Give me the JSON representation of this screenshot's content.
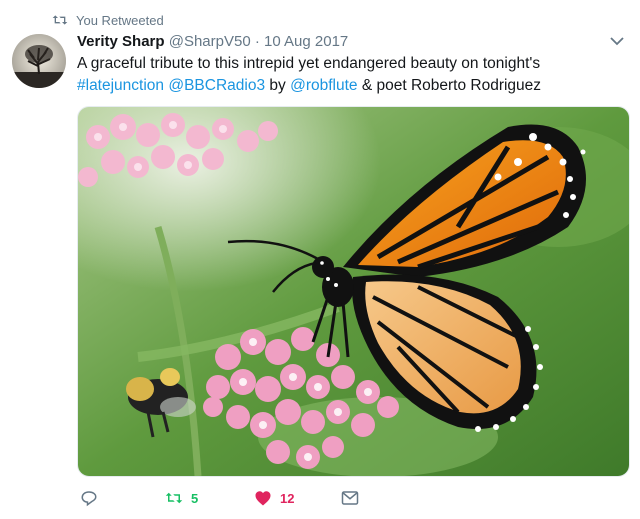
{
  "retweet_notice": "You Retweeted",
  "tweet": {
    "author_name": "Verity Sharp",
    "handle": "@SharpV50",
    "separator": "·",
    "date": "10 Aug 2017",
    "text_line1": "A graceful tribute to this intrepid yet endangered beauty on tonight's",
    "hashtag": "#latejunction",
    "mention1": "@BBCRadio3",
    "by": " by ",
    "mention2": "@robflute",
    "tail": " & poet Roberto Rodriguez"
  },
  "actions": {
    "retweet_count": "5",
    "like_count": "12"
  },
  "colors": {
    "link": "#1b95e0",
    "retweet_active": "#17bf63",
    "like_active": "#e0245e",
    "muted": "#657786"
  },
  "icons": [
    "retweet-icon",
    "chevron-down-icon",
    "reply-icon",
    "heart-icon",
    "direct-message-icon"
  ]
}
